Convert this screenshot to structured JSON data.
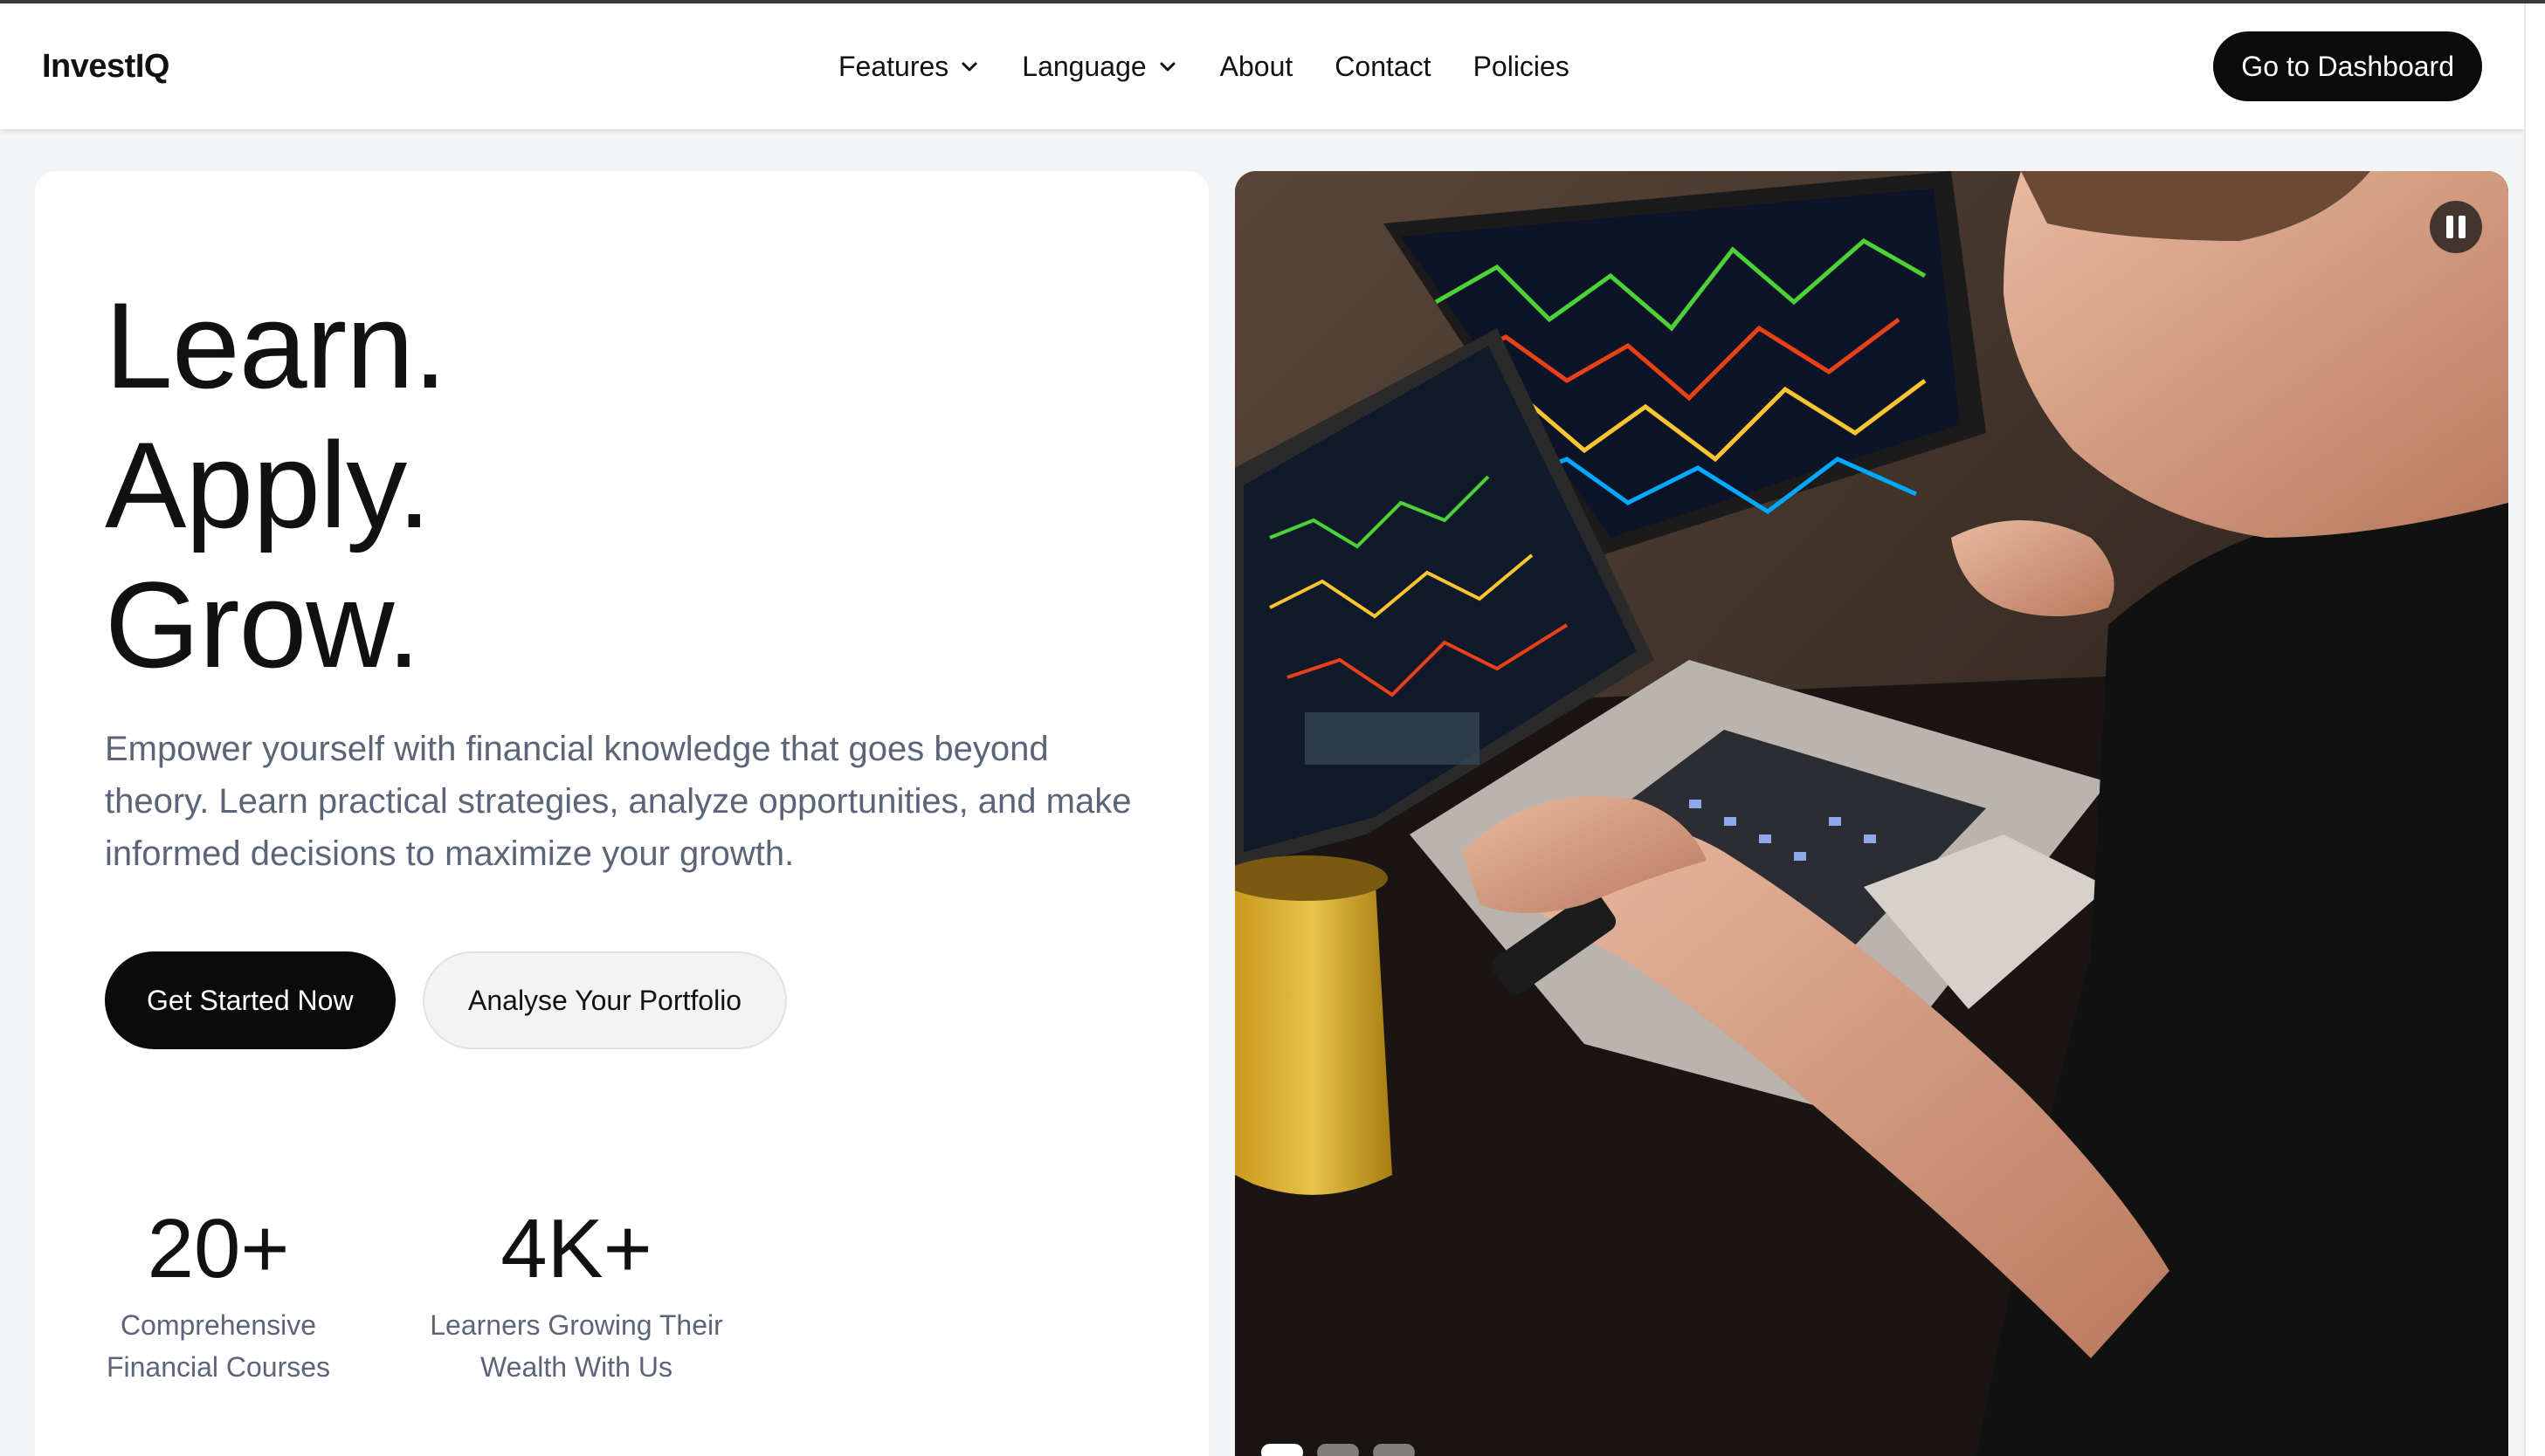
{
  "navbar": {
    "brand": "InvestIQ",
    "items": [
      {
        "label": "Features",
        "has_dropdown": true
      },
      {
        "label": "Language",
        "has_dropdown": true
      },
      {
        "label": "About",
        "has_dropdown": false
      },
      {
        "label": "Contact",
        "has_dropdown": false
      },
      {
        "label": "Policies",
        "has_dropdown": false
      }
    ],
    "cta_label": "Go to Dashboard"
  },
  "hero": {
    "headline": [
      "Learn.",
      "Apply.",
      "Grow."
    ],
    "description": "Empower yourself with financial knowledge that goes beyond theory. Learn practical strategies, analyze opportunities, and make informed decisions to maximize your growth.",
    "primary_button": "Get Started Now",
    "secondary_button": "Analyse Your Portfolio",
    "stats": [
      {
        "value": "20+",
        "label_line1": "Comprehensive",
        "label_line2": "Financial Courses"
      },
      {
        "value": "4K+",
        "label_line1": "Learners Growing Their",
        "label_line2": "Wealth With Us"
      }
    ]
  },
  "carousel": {
    "image_alt": "Person trading on laptop with multiple stock chart monitors",
    "pause_icon": "pause-icon",
    "slides_count": 3,
    "active_slide": 1
  },
  "colors": {
    "dark": "#0b0b0b",
    "muted_text": "#5b6578",
    "page_bg": "#f3f4f6"
  }
}
